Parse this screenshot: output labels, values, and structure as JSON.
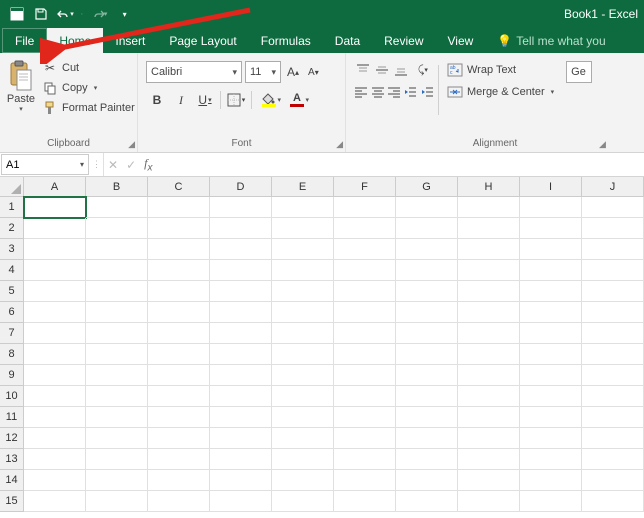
{
  "title": "Book1 - Excel",
  "qat_items": [
    "save",
    "undo",
    "redo"
  ],
  "tabs": {
    "file": "File",
    "home": "Home",
    "insert": "Insert",
    "page_layout": "Page Layout",
    "formulas": "Formulas",
    "data": "Data",
    "review": "Review",
    "view": "View",
    "tell_me": "Tell me what you"
  },
  "ribbon": {
    "clipboard": {
      "label": "Clipboard",
      "paste": "Paste",
      "cut": "Cut",
      "copy": "Copy",
      "format_painter": "Format Painter"
    },
    "font": {
      "label": "Font",
      "name": "Calibri",
      "size": "11",
      "bold": "B",
      "italic": "I",
      "underline": "U",
      "border_icon": "border",
      "fill_color": "#FFFF00",
      "font_color": "#C00000",
      "grow": "A",
      "shrink": "A"
    },
    "alignment": {
      "label": "Alignment",
      "wrap_text": "Wrap Text",
      "merge_center": "Merge & Center"
    }
  },
  "namebox": "A1",
  "formula_bar": "",
  "columns": [
    "A",
    "B",
    "C",
    "D",
    "E",
    "F",
    "G",
    "H",
    "I",
    "J"
  ],
  "rows": [
    "1",
    "2",
    "3",
    "4",
    "5",
    "6",
    "7",
    "8",
    "9",
    "10",
    "11",
    "12",
    "13",
    "14",
    "15"
  ],
  "active_cell": {
    "row": 0,
    "col": 0
  },
  "tell_me_partial": "Ge"
}
